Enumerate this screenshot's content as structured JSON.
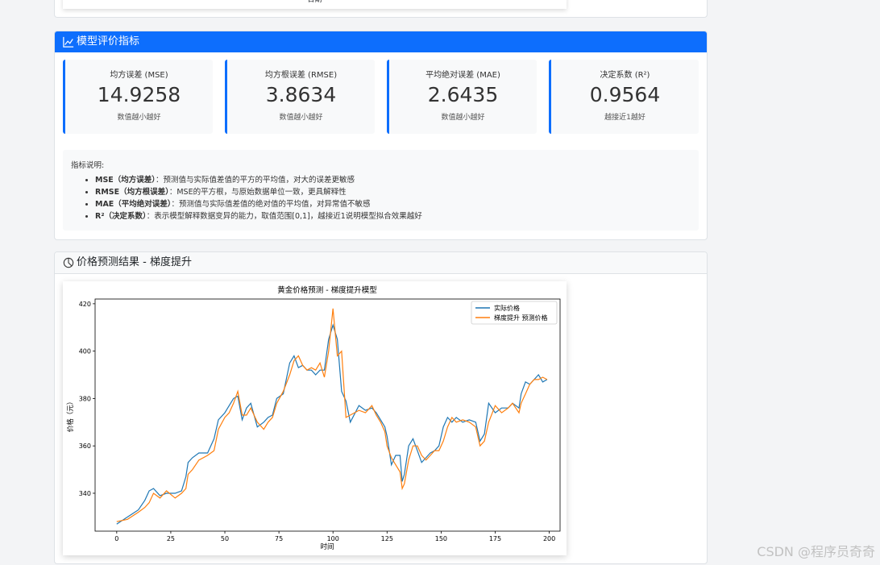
{
  "top_fragment_text": "日期",
  "metrics_card": {
    "title": "模型评价指标",
    "metrics": [
      {
        "label": "均方误差 (MSE)",
        "value": "14.9258",
        "note": "数值越小越好"
      },
      {
        "label": "均方根误差 (RMSE)",
        "value": "3.8634",
        "note": "数值越小越好"
      },
      {
        "label": "平均绝对误差 (MAE)",
        "value": "2.6435",
        "note": "数值越小越好"
      },
      {
        "label": "决定系数 (R²)",
        "value": "0.9564",
        "note": "越接近1越好"
      }
    ],
    "explain_title": "指标说明:",
    "explain_items": [
      {
        "term": "MSE（均方误差）",
        "desc": "：预测值与实际值差值的平方的平均值，对大的误差更敏感"
      },
      {
        "term": "RMSE（均方根误差）",
        "desc": "：MSE的平方根，与原始数据单位一致，更具解释性"
      },
      {
        "term": "MAE（平均绝对误差）",
        "desc": "：预测值与实际值差值的绝对值的平均值，对异常值不敏感"
      },
      {
        "term": "R²（决定系数）",
        "desc": "：表示模型解释数据变异的能力，取值范围[0,1]，越接近1说明模型拟合效果越好"
      }
    ]
  },
  "chart_card": {
    "title": "价格预测结果 - 梯度提升"
  },
  "accent_color": "#0d6efd",
  "watermark": "CSDN @程序员奇奇",
  "chart_data": {
    "type": "line",
    "title": "黄金价格预测 - 梯度提升模型",
    "xlabel": "时间",
    "ylabel": "价格（元）",
    "xlim": [
      -10,
      205
    ],
    "ylim": [
      324,
      422
    ],
    "xticks": [
      0,
      25,
      50,
      75,
      100,
      125,
      150,
      175,
      200
    ],
    "yticks": [
      340,
      360,
      380,
      400,
      420
    ],
    "legend_position": "top-right",
    "series": [
      {
        "name": "实际价格",
        "color": "#1f77b4",
        "points": [
          [
            0,
            327
          ],
          [
            5,
            330
          ],
          [
            10,
            333
          ],
          [
            13,
            337
          ],
          [
            15,
            341
          ],
          [
            17,
            342
          ],
          [
            20,
            339
          ],
          [
            23,
            340
          ],
          [
            27,
            340
          ],
          [
            30,
            341
          ],
          [
            32,
            347
          ],
          [
            33,
            353
          ],
          [
            35,
            355
          ],
          [
            38,
            357
          ],
          [
            42,
            357
          ],
          [
            45,
            363
          ],
          [
            47,
            371
          ],
          [
            50,
            374
          ],
          [
            52,
            377
          ],
          [
            54,
            380
          ],
          [
            56,
            381
          ],
          [
            58,
            371
          ],
          [
            60,
            376
          ],
          [
            62,
            378
          ],
          [
            65,
            368
          ],
          [
            68,
            370
          ],
          [
            70,
            372
          ],
          [
            72,
            373
          ],
          [
            74,
            380
          ],
          [
            77,
            382
          ],
          [
            80,
            395
          ],
          [
            82,
            398
          ],
          [
            84,
            393
          ],
          [
            86,
            394
          ],
          [
            88,
            392
          ],
          [
            90,
            392
          ],
          [
            92,
            390
          ],
          [
            94,
            392
          ],
          [
            96,
            392
          ],
          [
            98,
            405
          ],
          [
            100,
            411
          ],
          [
            102,
            405
          ],
          [
            104,
            383
          ],
          [
            106,
            379
          ],
          [
            108,
            370
          ],
          [
            112,
            377
          ],
          [
            115,
            375
          ],
          [
            118,
            376
          ],
          [
            120,
            374
          ],
          [
            122,
            371
          ],
          [
            124,
            368
          ],
          [
            125,
            364
          ],
          [
            127,
            352
          ],
          [
            129,
            356
          ],
          [
            131,
            356
          ],
          [
            132,
            345
          ],
          [
            133,
            348
          ],
          [
            135,
            360
          ],
          [
            137,
            363
          ],
          [
            139,
            358
          ],
          [
            141,
            353
          ],
          [
            143,
            355
          ],
          [
            145,
            357
          ],
          [
            147,
            358
          ],
          [
            149,
            360
          ],
          [
            151,
            368
          ],
          [
            153,
            372
          ],
          [
            155,
            370
          ],
          [
            157,
            372
          ],
          [
            160,
            370
          ],
          [
            163,
            371
          ],
          [
            166,
            370
          ],
          [
            168,
            362
          ],
          [
            170,
            365
          ],
          [
            172,
            378
          ],
          [
            175,
            374
          ],
          [
            178,
            376
          ],
          [
            181,
            376
          ],
          [
            183,
            378
          ],
          [
            186,
            376
          ],
          [
            187,
            382
          ],
          [
            189,
            387
          ],
          [
            191,
            386
          ],
          [
            193,
            388
          ],
          [
            195,
            390
          ],
          [
            197,
            387
          ],
          [
            199,
            388
          ]
        ]
      },
      {
        "name": "梯度提升 预测价格",
        "color": "#ff7f0e",
        "points": [
          [
            0,
            328
          ],
          [
            5,
            329
          ],
          [
            10,
            332
          ],
          [
            13,
            334
          ],
          [
            15,
            336
          ],
          [
            17,
            340
          ],
          [
            20,
            338
          ],
          [
            23,
            341
          ],
          [
            27,
            338
          ],
          [
            30,
            340
          ],
          [
            32,
            342
          ],
          [
            33,
            348
          ],
          [
            35,
            350
          ],
          [
            38,
            354
          ],
          [
            42,
            356
          ],
          [
            45,
            358
          ],
          [
            47,
            367
          ],
          [
            50,
            372
          ],
          [
            52,
            374
          ],
          [
            54,
            378
          ],
          [
            56,
            383
          ],
          [
            58,
            373
          ],
          [
            60,
            373
          ],
          [
            62,
            376
          ],
          [
            65,
            370
          ],
          [
            68,
            367
          ],
          [
            70,
            370
          ],
          [
            72,
            372
          ],
          [
            74,
            378
          ],
          [
            77,
            383
          ],
          [
            80,
            390
          ],
          [
            82,
            396
          ],
          [
            84,
            398
          ],
          [
            86,
            394
          ],
          [
            88,
            392
          ],
          [
            90,
            393
          ],
          [
            92,
            392
          ],
          [
            94,
            395
          ],
          [
            96,
            389
          ],
          [
            98,
            400
          ],
          [
            100,
            418
          ],
          [
            102,
            398
          ],
          [
            104,
            400
          ],
          [
            106,
            372
          ],
          [
            108,
            373
          ],
          [
            112,
            375
          ],
          [
            115,
            374
          ],
          [
            118,
            377
          ],
          [
            120,
            373
          ],
          [
            122,
            370
          ],
          [
            124,
            366
          ],
          [
            125,
            360
          ],
          [
            127,
            355
          ],
          [
            129,
            352
          ],
          [
            131,
            349
          ],
          [
            132,
            342
          ],
          [
            133,
            344
          ],
          [
            135,
            354
          ],
          [
            137,
            360
          ],
          [
            139,
            360
          ],
          [
            141,
            356
          ],
          [
            143,
            354
          ],
          [
            145,
            356
          ],
          [
            147,
            358
          ],
          [
            149,
            358
          ],
          [
            151,
            362
          ],
          [
            153,
            368
          ],
          [
            155,
            372
          ],
          [
            157,
            370
          ],
          [
            160,
            371
          ],
          [
            163,
            370
          ],
          [
            166,
            368
          ],
          [
            168,
            360
          ],
          [
            170,
            362
          ],
          [
            172,
            370
          ],
          [
            175,
            377
          ],
          [
            178,
            374
          ],
          [
            181,
            376
          ],
          [
            183,
            378
          ],
          [
            186,
            374
          ],
          [
            187,
            378
          ],
          [
            189,
            382
          ],
          [
            191,
            386
          ],
          [
            193,
            388
          ],
          [
            195,
            388
          ],
          [
            197,
            389
          ],
          [
            199,
            388
          ]
        ]
      }
    ]
  }
}
